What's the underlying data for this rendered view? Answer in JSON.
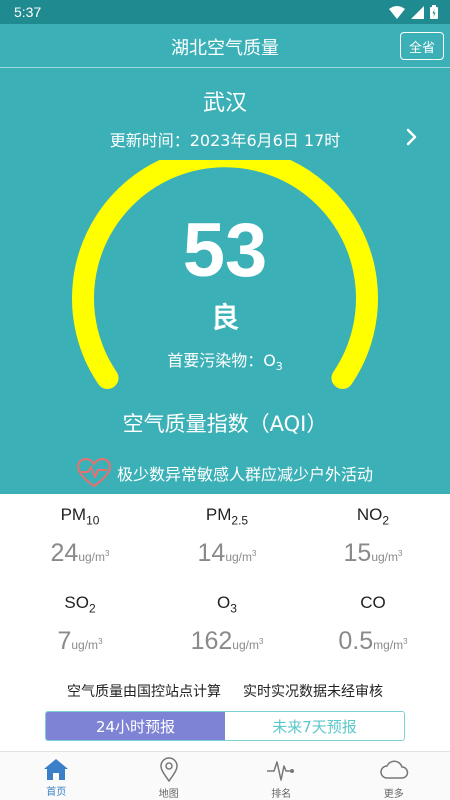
{
  "status_bar": {
    "time": "5:37"
  },
  "header": {
    "title": "湖北空气质量",
    "province_button": "全省"
  },
  "city": "武汉",
  "update_time": "更新时间：2023年6月6日 17时",
  "aqi": {
    "value": "53",
    "level": "良",
    "primary_pollutant_label": "首要污染物：O",
    "primary_pollutant_sub": "3",
    "index_label": "空气质量指数（AQI）",
    "gauge_color": "#ffff00"
  },
  "advice": "极少数异常敏感人群应减少户外活动",
  "metrics": [
    {
      "name": "PM",
      "sub": "10",
      "value": "24",
      "unit": "ug/m",
      "unit_sup": "3"
    },
    {
      "name": "PM",
      "sub": "2.5",
      "value": "14",
      "unit": "ug/m",
      "unit_sup": "3"
    },
    {
      "name": "NO",
      "sub": "2",
      "value": "15",
      "unit": "ug/m",
      "unit_sup": "3"
    },
    {
      "name": "SO",
      "sub": "2",
      "value": "7",
      "unit": "ug/m",
      "unit_sup": "3"
    },
    {
      "name": "O",
      "sub": "3",
      "value": "162",
      "unit": "ug/m",
      "unit_sup": "3"
    },
    {
      "name": "CO",
      "sub": "",
      "value": "0.5",
      "unit": "mg/m",
      "unit_sup": "3"
    }
  ],
  "notes": {
    "left": "空气质量由国控站点计算",
    "right": "实时实况数据未经审核"
  },
  "forecast_tabs": {
    "active": "24小时预报",
    "inactive": "未来7天预报"
  },
  "bottom_nav": [
    {
      "label": "首页",
      "icon": "home-icon"
    },
    {
      "label": "地图",
      "icon": "map-pin-icon"
    },
    {
      "label": "排名",
      "icon": "pulse-icon"
    },
    {
      "label": "更多",
      "icon": "cloud-icon"
    }
  ],
  "colors": {
    "teal": "#3bb1b7",
    "status_bar": "#1f8a8f",
    "gauge": "#ffff00",
    "active_tab": "#7e83d6",
    "nav_active": "#3a80c9"
  }
}
